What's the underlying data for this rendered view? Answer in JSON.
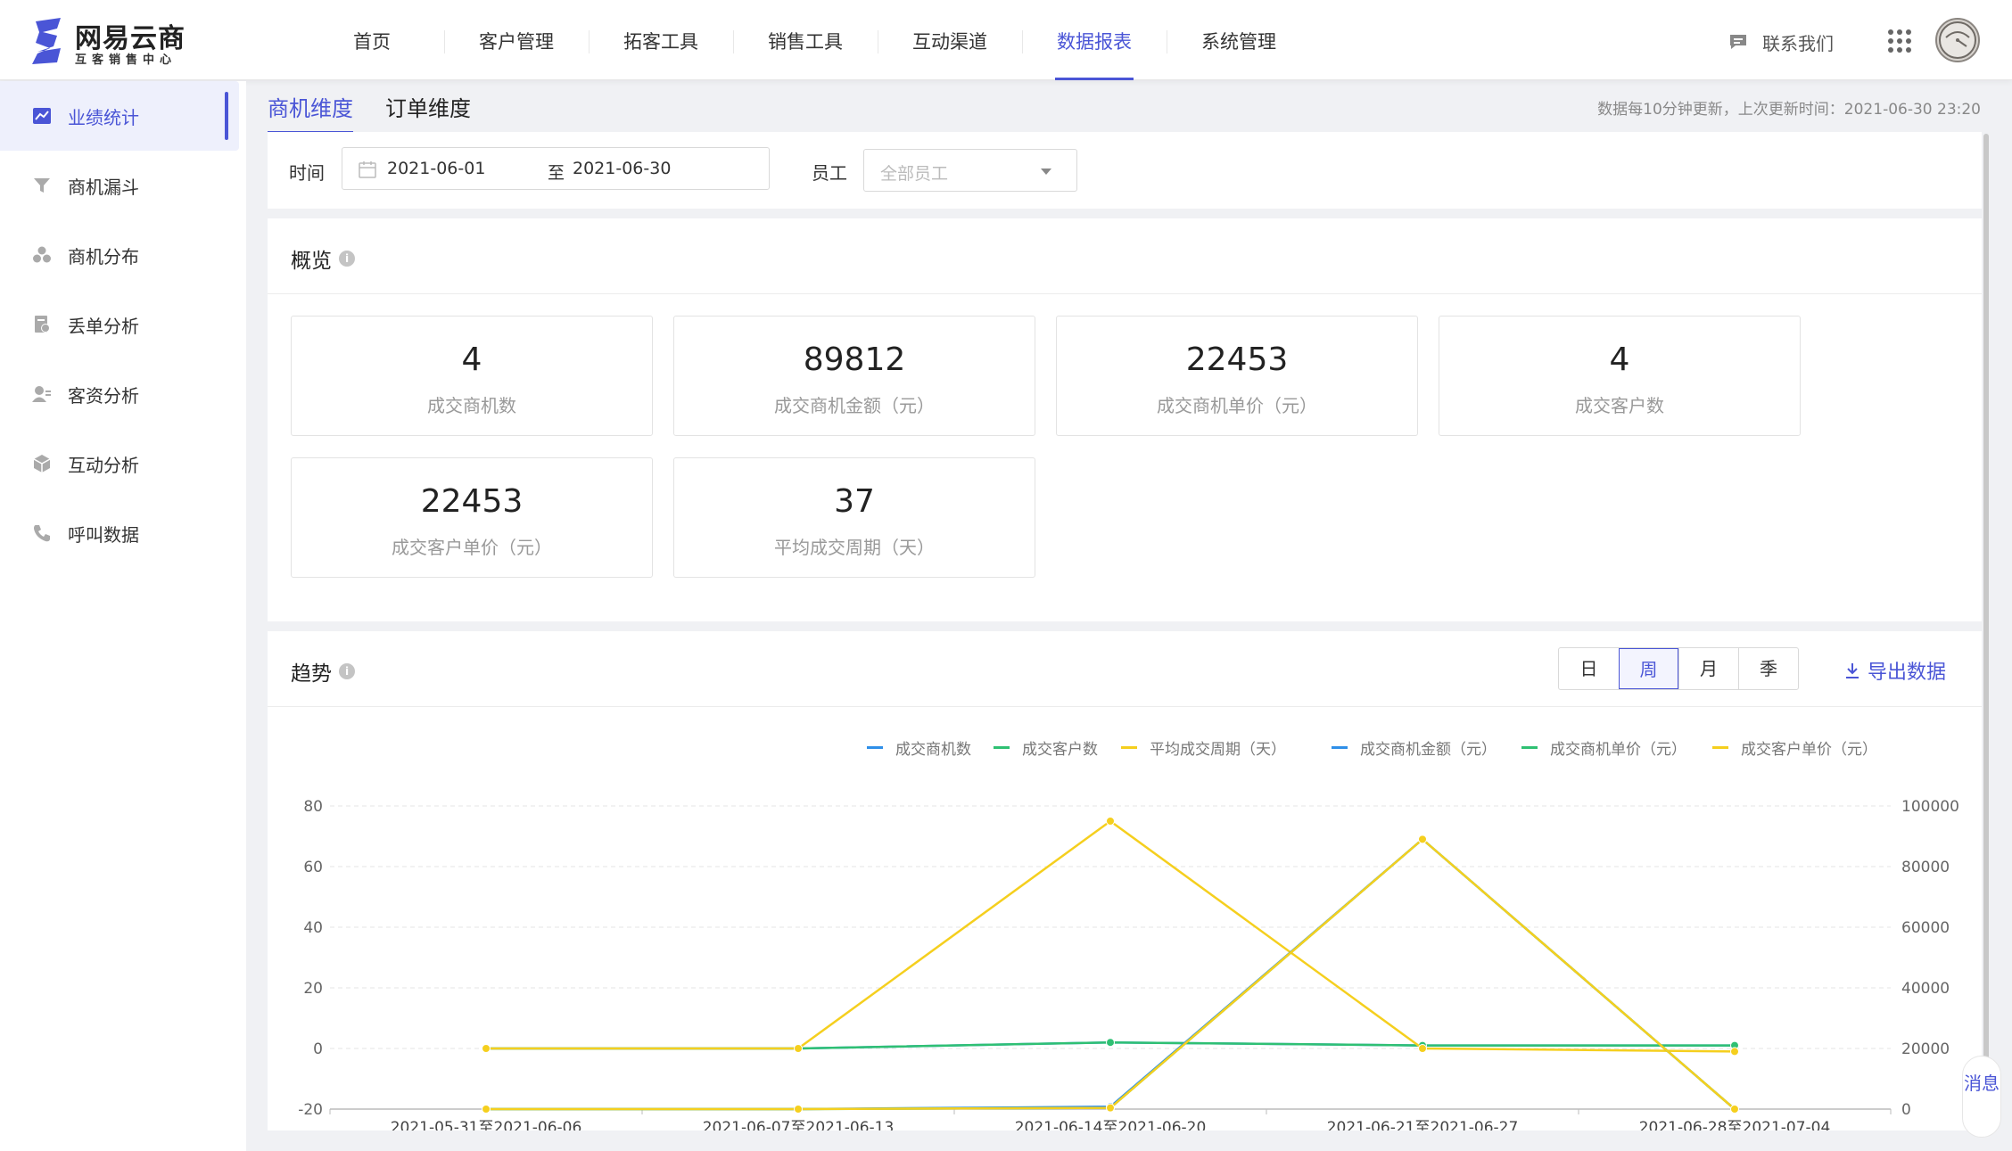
{
  "brand": {
    "name": "网易云商",
    "subtitle": "互客销售中心",
    "color": "#4a55d6"
  },
  "nav": {
    "items": [
      {
        "label": "首页"
      },
      {
        "label": "客户管理"
      },
      {
        "label": "拓客工具"
      },
      {
        "label": "销售工具"
      },
      {
        "label": "互动渠道"
      },
      {
        "label": "数据报表",
        "active": true
      },
      {
        "label": "系统管理"
      }
    ],
    "contact_label": "联系我们"
  },
  "sidebar": {
    "items": [
      {
        "label": "业绩统计",
        "icon": "trend-chart-icon",
        "active": true
      },
      {
        "label": "商机漏斗",
        "icon": "funnel-icon"
      },
      {
        "label": "商机分布",
        "icon": "distribution-icon"
      },
      {
        "label": "丢单分析",
        "icon": "lost-order-icon"
      },
      {
        "label": "客资分析",
        "icon": "customer-icon"
      },
      {
        "label": "互动分析",
        "icon": "cube-icon"
      },
      {
        "label": "呼叫数据",
        "icon": "phone-icon"
      }
    ]
  },
  "tabs": [
    {
      "label": "商机维度",
      "active": true
    },
    {
      "label": "订单维度"
    }
  ],
  "update_note": "数据每10分钟更新，上次更新时间：2021-06-30 23:20",
  "filters": {
    "time_label": "时间",
    "start_date": "2021-06-01",
    "range_sep": "至",
    "end_date": "2021-06-30",
    "employee_label": "员工",
    "employee_placeholder": "全部员工"
  },
  "overview": {
    "title": "概览",
    "info": "i",
    "stats": [
      {
        "value": "4",
        "label": "成交商机数"
      },
      {
        "value": "89812",
        "label": "成交商机金额（元）"
      },
      {
        "value": "22453",
        "label": "成交商机单价（元）"
      },
      {
        "value": "4",
        "label": "成交客户数"
      },
      {
        "value": "22453",
        "label": "成交客户单价（元）"
      },
      {
        "value": "37",
        "label": "平均成交周期（天）"
      }
    ]
  },
  "trend": {
    "title": "趋势",
    "info": "i",
    "periods": [
      {
        "label": "日"
      },
      {
        "label": "周",
        "active": true
      },
      {
        "label": "月"
      },
      {
        "label": "季"
      }
    ],
    "export_label": "导出数据"
  },
  "message_float": {
    "label": "消息"
  },
  "chart_data": {
    "type": "line",
    "categories": [
      "2021-05-31至2021-06-06",
      "2021-06-07至2021-06-13",
      "2021-06-14至2021-06-20",
      "2021-06-21至2021-06-27",
      "2021-06-28至2021-07-04"
    ],
    "y_left": {
      "min": -20,
      "max": 80,
      "ticks": [
        "80",
        "60",
        "40",
        "20",
        "0",
        "-20"
      ]
    },
    "y_right": {
      "min": 0,
      "max": 100000,
      "ticks": [
        "100000",
        "80000",
        "60000",
        "40000",
        "20000",
        "0"
      ]
    },
    "grid": true,
    "legend_position": "top",
    "series": [
      {
        "name": "成交商机数",
        "color": "#2f8fe8",
        "axis": "left",
        "values": [
          0,
          0,
          2,
          1,
          1
        ]
      },
      {
        "name": "成交客户数",
        "color": "#2fc073",
        "axis": "left",
        "values": [
          0,
          0,
          2,
          1,
          1
        ]
      },
      {
        "name": "平均成交周期（天）",
        "color": "#f5cf1e",
        "axis": "left",
        "values": [
          0,
          0,
          75,
          0,
          -1
        ]
      },
      {
        "name": "成交商机金额（元）",
        "color": "#2f8fe8",
        "axis": "right",
        "values": [
          0,
          0,
          800,
          89012,
          0
        ]
      },
      {
        "name": "成交商机单价（元）",
        "color": "#2fc073",
        "axis": "right",
        "values": [
          0,
          0,
          400,
          89012,
          0
        ]
      },
      {
        "name": "成交客户单价（元）",
        "color": "#f5cf1e",
        "axis": "right",
        "values": [
          0,
          0,
          400,
          89012,
          0
        ]
      }
    ]
  }
}
